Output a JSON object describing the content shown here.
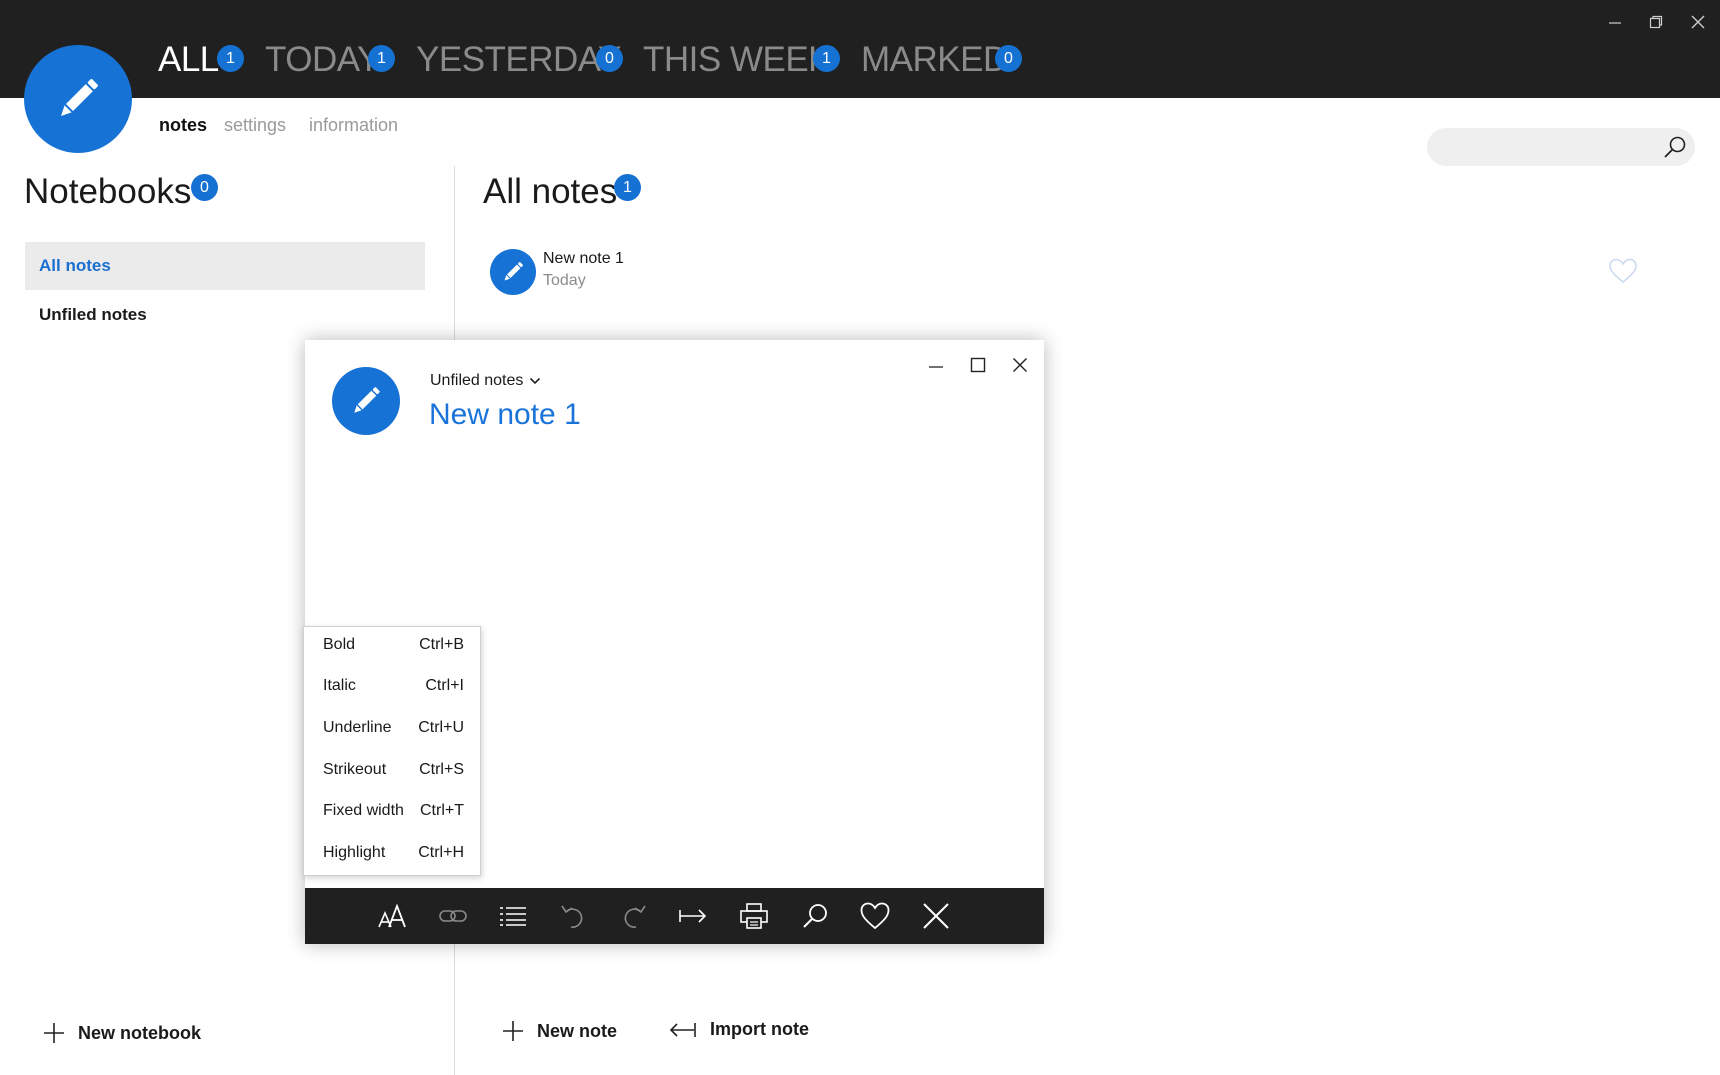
{
  "window_controls": {
    "minimize_icon": "minimize-icon",
    "restore_icon": "restore-icon",
    "close_icon": "close-icon"
  },
  "categories": [
    {
      "label": "ALL",
      "count": "1",
      "active": true
    },
    {
      "label": "TODAY",
      "count": "1",
      "active": false
    },
    {
      "label": "YESTERDAY",
      "count": "0",
      "active": false
    },
    {
      "label": "THIS WEEK",
      "count": "1",
      "active": false
    },
    {
      "label": "MARKED",
      "count": "0",
      "active": false
    }
  ],
  "subnav": [
    {
      "label": "notes",
      "active": true
    },
    {
      "label": "settings",
      "active": false
    },
    {
      "label": "information",
      "active": false
    }
  ],
  "search": {
    "placeholder": "",
    "value": ""
  },
  "notebooks": {
    "title": "Notebooks",
    "count": "0",
    "items": [
      {
        "label": "All notes",
        "selected": true
      },
      {
        "label": "Unfiled notes",
        "selected": false
      }
    ],
    "new_label": "New notebook"
  },
  "notes": {
    "title": "All notes",
    "count": "1",
    "items": [
      {
        "title": "New note 1",
        "date": "Today"
      }
    ],
    "new_label": "New note",
    "import_label": "Import note"
  },
  "editor": {
    "notebook": "Unfiled notes",
    "title": "New note 1",
    "toolbar": [
      "font-size-icon",
      "link-icon",
      "list-icon",
      "undo-icon",
      "redo-icon",
      "indent-icon",
      "print-icon",
      "search-icon",
      "heart-icon",
      "delete-icon"
    ]
  },
  "context_menu": [
    {
      "label": "Bold",
      "shortcut": "Ctrl+B"
    },
    {
      "label": "Italic",
      "shortcut": "Ctrl+I"
    },
    {
      "label": "Underline",
      "shortcut": "Ctrl+U"
    },
    {
      "label": "Strikeout",
      "shortcut": "Ctrl+S"
    },
    {
      "label": "Fixed width",
      "shortcut": "Ctrl+T"
    },
    {
      "label": "Highlight",
      "shortcut": "Ctrl+H"
    }
  ],
  "colors": {
    "accent": "#1672d5",
    "topbar": "#202020",
    "selected_bg": "#ebebeb",
    "title_blue": "#1a73d9"
  }
}
